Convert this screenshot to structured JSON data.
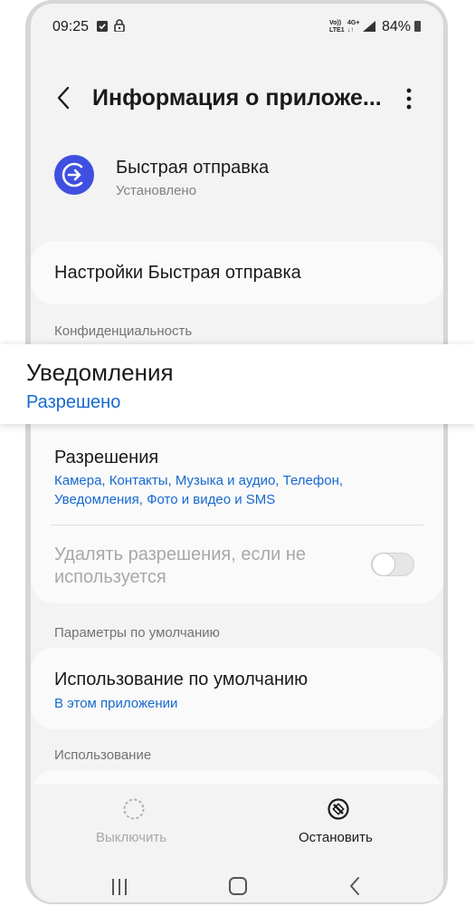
{
  "status_bar": {
    "time": "09:25",
    "network_top": "Vo))",
    "network_bottom": "LTE1",
    "network_type": "4G+",
    "battery": "84%"
  },
  "header": {
    "title": "Информация о приложе..."
  },
  "app": {
    "name": "Быстрая отправка",
    "status": "Установлено",
    "icon_color": "#3f4fe0"
  },
  "settings_item": {
    "label": "Настройки Быстрая отправка"
  },
  "privacy_section": {
    "title": "Конфиденциальность"
  },
  "notifications": {
    "label": "Уведомления",
    "value": "Разрешено"
  },
  "permissions": {
    "label": "Разрешения",
    "value_line1": "Камера, Контакты, Музыка и аудио, Телефон,",
    "value_line2": "Уведомления, Фото и видео и SMS"
  },
  "remove_permissions": {
    "line1": "Удалять разрешения, если не",
    "line2": "используется",
    "enabled": false
  },
  "defaults_section": {
    "title": "Параметры по умолчанию"
  },
  "default_usage": {
    "label": "Использование по умолчанию",
    "value": "В этом приложении"
  },
  "usage_section": {
    "title": "Использование"
  },
  "bottom_actions": {
    "disable_label": "Выключить",
    "stop_label": "Остановить"
  },
  "colors": {
    "accent": "#1769cf",
    "background": "#f3f3f3",
    "card": "#fafafa"
  }
}
